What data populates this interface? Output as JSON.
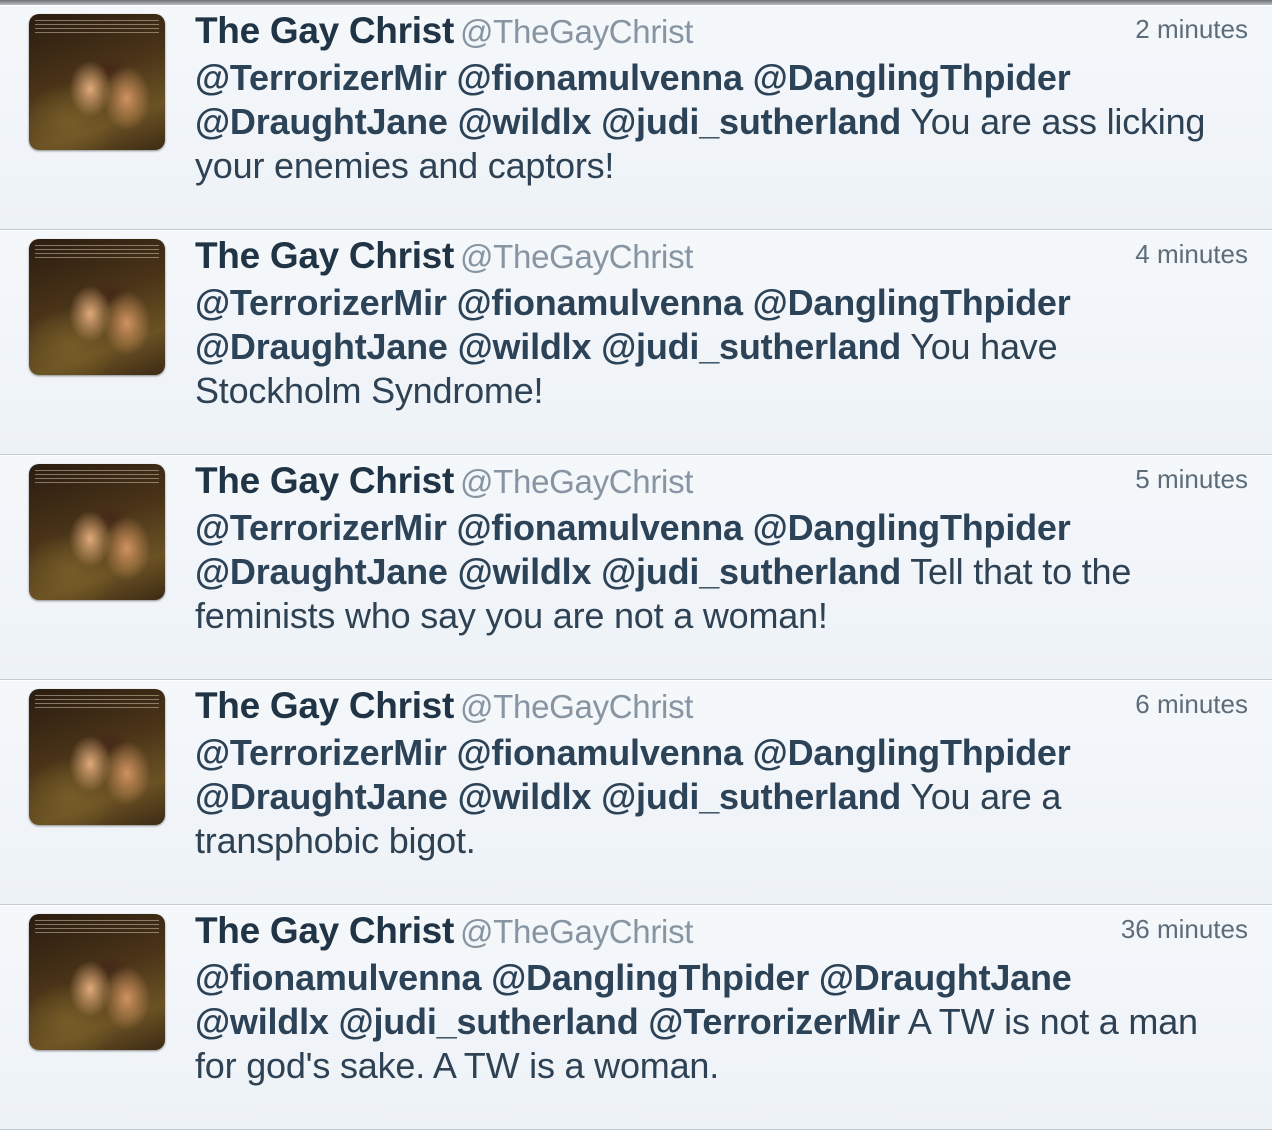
{
  "tweets": [
    {
      "name": "The Gay Christ",
      "handle": "@TheGayChrist",
      "time": "2 minutes",
      "lines": [
        [
          {
            "text": "@TerrorizerMir",
            "type": "mention"
          },
          {
            "text": " ",
            "type": "plain"
          },
          {
            "text": "@fionamulvenna",
            "type": "mention"
          },
          {
            "text": " ",
            "type": "plain"
          },
          {
            "text": "@DanglingThpider",
            "type": "mention"
          }
        ],
        [
          {
            "text": "@DraughtJane",
            "type": "mention"
          },
          {
            "text": " ",
            "type": "plain"
          },
          {
            "text": "@wildlx",
            "type": "mention"
          },
          {
            "text": " ",
            "type": "plain"
          },
          {
            "text": "@judi_sutherland",
            "type": "mention"
          },
          {
            "text": " You are ass licking",
            "type": "plain"
          }
        ],
        [
          {
            "text": "your enemies and captors!",
            "type": "plain"
          }
        ]
      ]
    },
    {
      "name": "The Gay Christ",
      "handle": "@TheGayChrist",
      "time": "4 minutes",
      "lines": [
        [
          {
            "text": "@TerrorizerMir",
            "type": "mention"
          },
          {
            "text": " ",
            "type": "plain"
          },
          {
            "text": "@fionamulvenna",
            "type": "mention"
          },
          {
            "text": " ",
            "type": "plain"
          },
          {
            "text": "@DanglingThpider",
            "type": "mention"
          }
        ],
        [
          {
            "text": "@DraughtJane",
            "type": "mention"
          },
          {
            "text": " ",
            "type": "plain"
          },
          {
            "text": "@wildlx",
            "type": "mention"
          },
          {
            "text": " ",
            "type": "plain"
          },
          {
            "text": "@judi_sutherland",
            "type": "mention"
          },
          {
            "text": " You have",
            "type": "plain"
          }
        ],
        [
          {
            "text": "Stockholm Syndrome!",
            "type": "plain"
          }
        ]
      ]
    },
    {
      "name": "The Gay Christ",
      "handle": "@TheGayChrist",
      "time": "5 minutes",
      "lines": [
        [
          {
            "text": "@TerrorizerMir",
            "type": "mention"
          },
          {
            "text": " ",
            "type": "plain"
          },
          {
            "text": "@fionamulvenna",
            "type": "mention"
          },
          {
            "text": " ",
            "type": "plain"
          },
          {
            "text": "@DanglingThpider",
            "type": "mention"
          }
        ],
        [
          {
            "text": "@DraughtJane",
            "type": "mention"
          },
          {
            "text": " ",
            "type": "plain"
          },
          {
            "text": "@wildlx",
            "type": "mention"
          },
          {
            "text": " ",
            "type": "plain"
          },
          {
            "text": "@judi_sutherland",
            "type": "mention"
          },
          {
            "text": " Tell that to the",
            "type": "plain"
          }
        ],
        [
          {
            "text": "feminists who say you are not a woman!",
            "type": "plain"
          }
        ]
      ]
    },
    {
      "name": "The Gay Christ",
      "handle": "@TheGayChrist",
      "time": "6 minutes",
      "lines": [
        [
          {
            "text": "@TerrorizerMir",
            "type": "mention"
          },
          {
            "text": " ",
            "type": "plain"
          },
          {
            "text": "@fionamulvenna",
            "type": "mention"
          },
          {
            "text": " ",
            "type": "plain"
          },
          {
            "text": "@DanglingThpider",
            "type": "mention"
          }
        ],
        [
          {
            "text": "@DraughtJane",
            "type": "mention"
          },
          {
            "text": " ",
            "type": "plain"
          },
          {
            "text": "@wildlx",
            "type": "mention"
          },
          {
            "text": " ",
            "type": "plain"
          },
          {
            "text": "@judi_sutherland",
            "type": "mention"
          },
          {
            "text": " You are a",
            "type": "plain"
          }
        ],
        [
          {
            "text": "transphobic bigot.",
            "type": "plain"
          }
        ]
      ]
    },
    {
      "name": "The Gay Christ",
      "handle": "@TheGayChrist",
      "time": "36 minutes",
      "lines": [
        [
          {
            "text": "@fionamulvenna",
            "type": "mention"
          },
          {
            "text": " ",
            "type": "plain"
          },
          {
            "text": "@DanglingThpider",
            "type": "mention"
          },
          {
            "text": " ",
            "type": "plain"
          },
          {
            "text": "@DraughtJane",
            "type": "mention"
          }
        ],
        [
          {
            "text": "@wildlx",
            "type": "mention"
          },
          {
            "text": " ",
            "type": "plain"
          },
          {
            "text": "@judi_sutherland",
            "type": "mention"
          },
          {
            "text": " ",
            "type": "plain"
          },
          {
            "text": "@TerrorizerMir",
            "type": "mention"
          },
          {
            "text": " A TW is not a man",
            "type": "plain"
          }
        ],
        [
          {
            "text": "for god's sake. A TW is a woman.",
            "type": "plain"
          }
        ]
      ]
    }
  ]
}
